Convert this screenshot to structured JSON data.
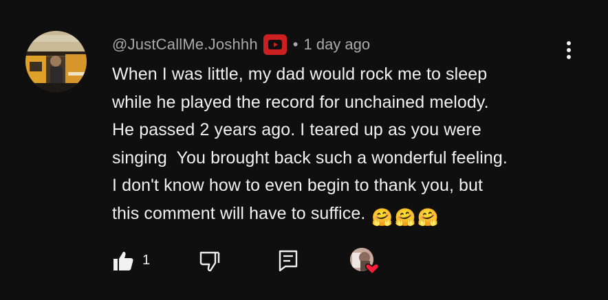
{
  "comment": {
    "author": "@JustCallMe.Joshhh",
    "separator": "•",
    "time": "1 day ago",
    "body_lines": [
      "When I was little, my dad would rock me to sleep",
      "while he played the record for unchained melody.",
      "He passed 2 years ago. I teared up as you were",
      "singing  You brought back such a wonderful feeling.",
      "I don't know how to even begin to thank you, but",
      "this comment will have to suffice. "
    ],
    "emojis": [
      "🤗",
      "🤗",
      "🤗"
    ],
    "like_count": "1"
  },
  "icons": {
    "avatar": "user-avatar",
    "badge": "youtube-badge-icon",
    "more": "more-vertical-icon",
    "like": "thumbs-up-icon",
    "dislike": "thumbs-down-icon",
    "reply": "reply-icon",
    "creator_heart": "creator-heart-icon"
  },
  "colors": {
    "background": "#0f0f0f",
    "text": "#f1f1f1",
    "muted": "#aaaaaa",
    "badge": "#cc1f1f",
    "heart": "#ff1f3d"
  }
}
